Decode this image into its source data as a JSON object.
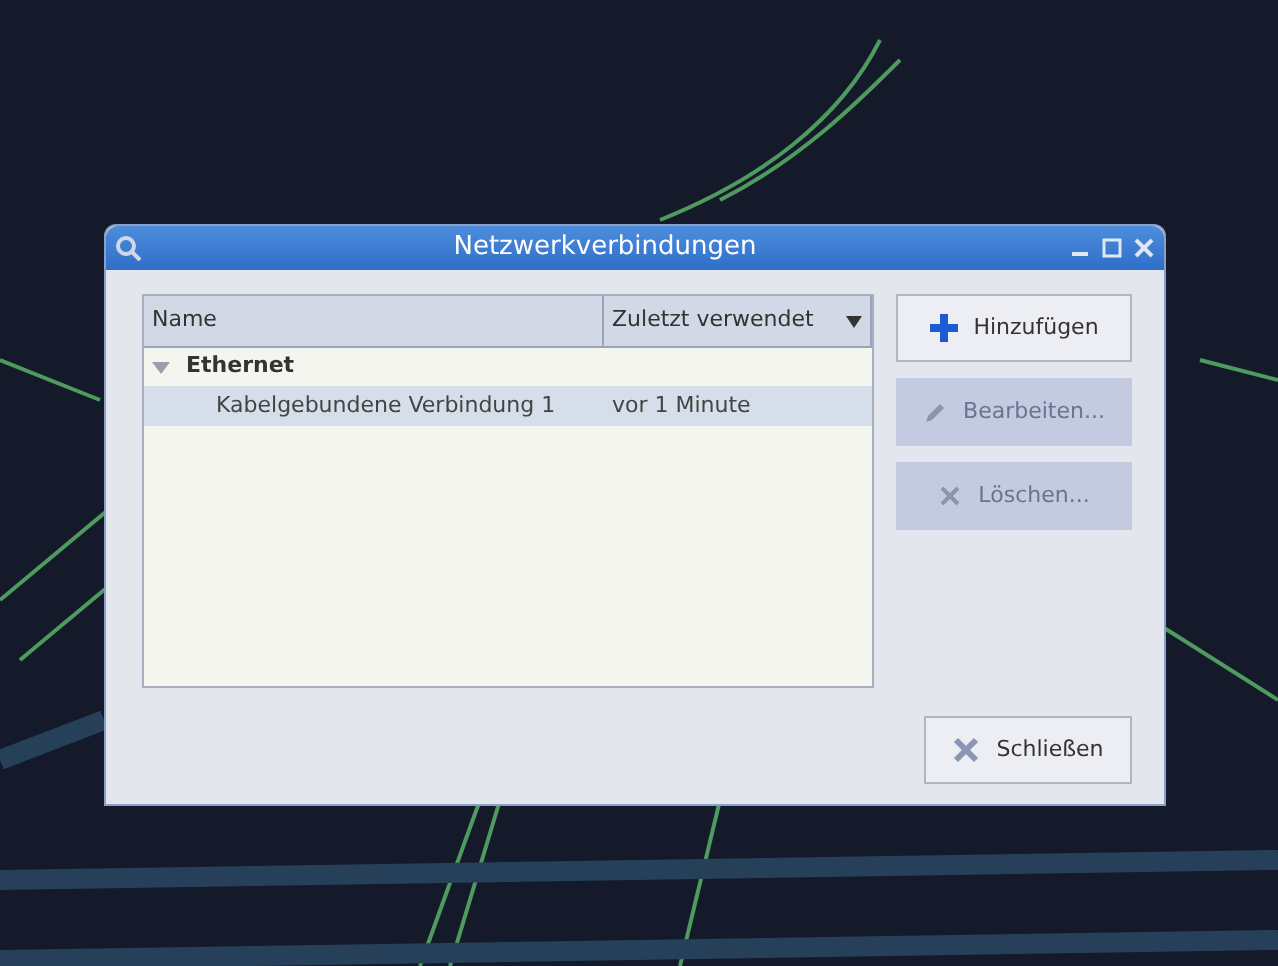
{
  "window": {
    "title": "Netzwerkverbindungen"
  },
  "table": {
    "columns": [
      {
        "label": "Name",
        "sorted": false
      },
      {
        "label": "Zuletzt verwendet",
        "sorted": true
      }
    ],
    "groups": [
      {
        "label": "Ethernet",
        "expanded": true,
        "children": [
          {
            "name": "Kabelgebundene Verbindung 1",
            "last_used": "vor 1 Minute",
            "selected": true
          }
        ]
      }
    ]
  },
  "buttons": [
    {
      "label": "Hinzufügen",
      "kind": "add",
      "disabled": false
    },
    {
      "label": "Bearbeiten...",
      "kind": "edit",
      "disabled": true
    },
    {
      "label": "Löschen...",
      "kind": "delete",
      "disabled": true
    }
  ],
  "close_button": {
    "label": "Schließen"
  }
}
